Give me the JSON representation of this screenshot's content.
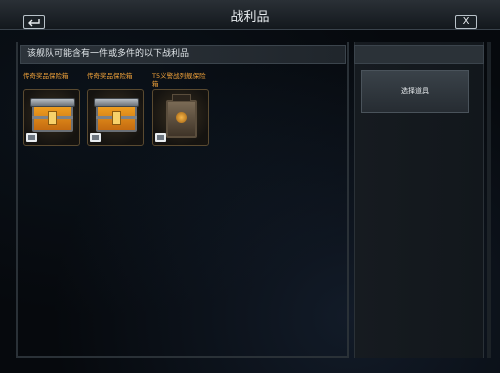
{
  "window": {
    "title": "战利品",
    "close_label": "X"
  },
  "notice": "该舰队可能含有一件或多件的以下战利品",
  "items": [
    {
      "name": "传奇奖品保险箱",
      "icon": "orange-crate-icon"
    },
    {
      "name": "传奇奖品保险箱",
      "icon": "orange-crate-icon"
    },
    {
      "name": "T5义警战列舰保险箱",
      "icon": "battleship-crate-icon"
    }
  ],
  "side_panel": {
    "select_button": "选择道具"
  },
  "colors": {
    "item_name": "#f2a33a",
    "panel": "#161b20",
    "topbar": "#2a3036"
  }
}
